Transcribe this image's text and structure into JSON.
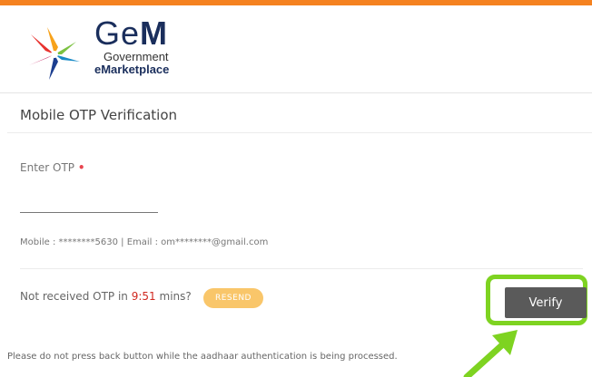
{
  "brand": {
    "name_prefix": "Ge",
    "name_suffix": "M",
    "line1": "Government",
    "line2": "eMarketplace",
    "accent_color": "#f58220"
  },
  "form": {
    "title": "Mobile OTP Verification",
    "otp_label": "Enter OTP",
    "required_mark": "•",
    "otp_value": "",
    "contact_info": "Mobile : ********5630 | Email : om********@gmail.com",
    "not_received_prefix": "Not received OTP in",
    "timer": "9:51",
    "not_received_suffix": "mins?",
    "resend_label": "RESEND",
    "verify_label": "Verify",
    "notice": "Please do not press back button while the aadhaar authentication is being processed."
  },
  "annotation": {
    "highlight_color": "#7ed321",
    "arrow_icon": "arrow-up-right-icon"
  }
}
